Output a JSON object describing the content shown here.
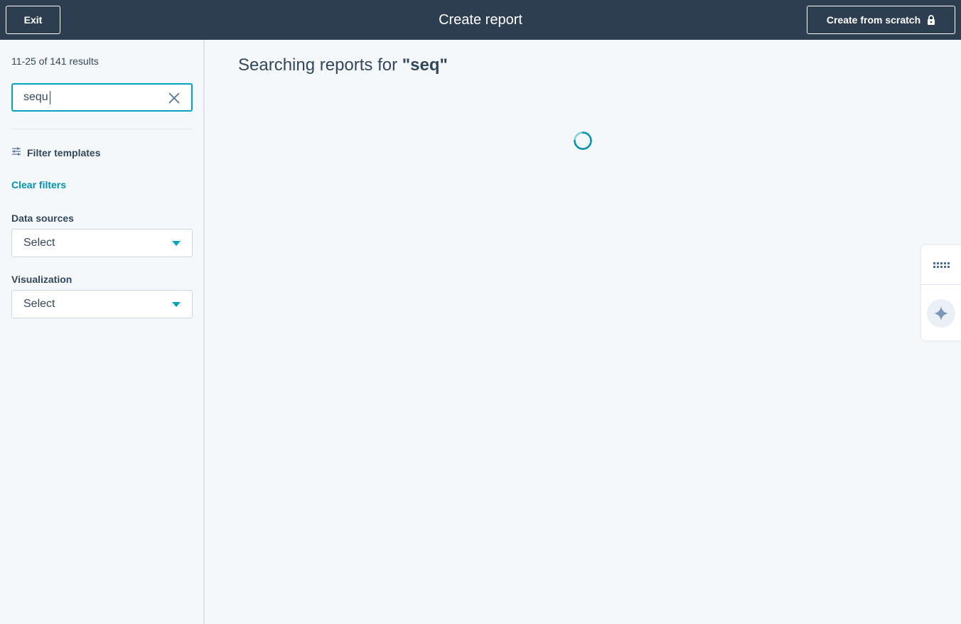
{
  "header": {
    "exit_label": "Exit",
    "title": "Create report",
    "create_from_scratch_label": "Create from scratch",
    "lock_icon": "lock-icon"
  },
  "sidebar": {
    "results_count": "11-25 of 141 results",
    "search": {
      "value": "sequ",
      "clear_icon": "close-icon"
    },
    "filter_title": "Filter templates",
    "filter_icon": "sliders-icon",
    "clear_filters_label": "Clear filters",
    "data_sources": {
      "label": "Data sources",
      "value": "Select"
    },
    "visualization": {
      "label": "Visualization",
      "value": "Select"
    }
  },
  "main": {
    "heading_prefix": "Searching reports for ",
    "heading_term": "\"seq\""
  },
  "side_widget": {
    "apps_icon": "grid-dots-icon",
    "assistant_icon": "sparkle-icon"
  },
  "colors": {
    "header_bg": "#2d3e50",
    "accent": "#00a4bd",
    "link": "#0091ae",
    "text": "#33475b",
    "page_bg": "#f5f8fa"
  }
}
